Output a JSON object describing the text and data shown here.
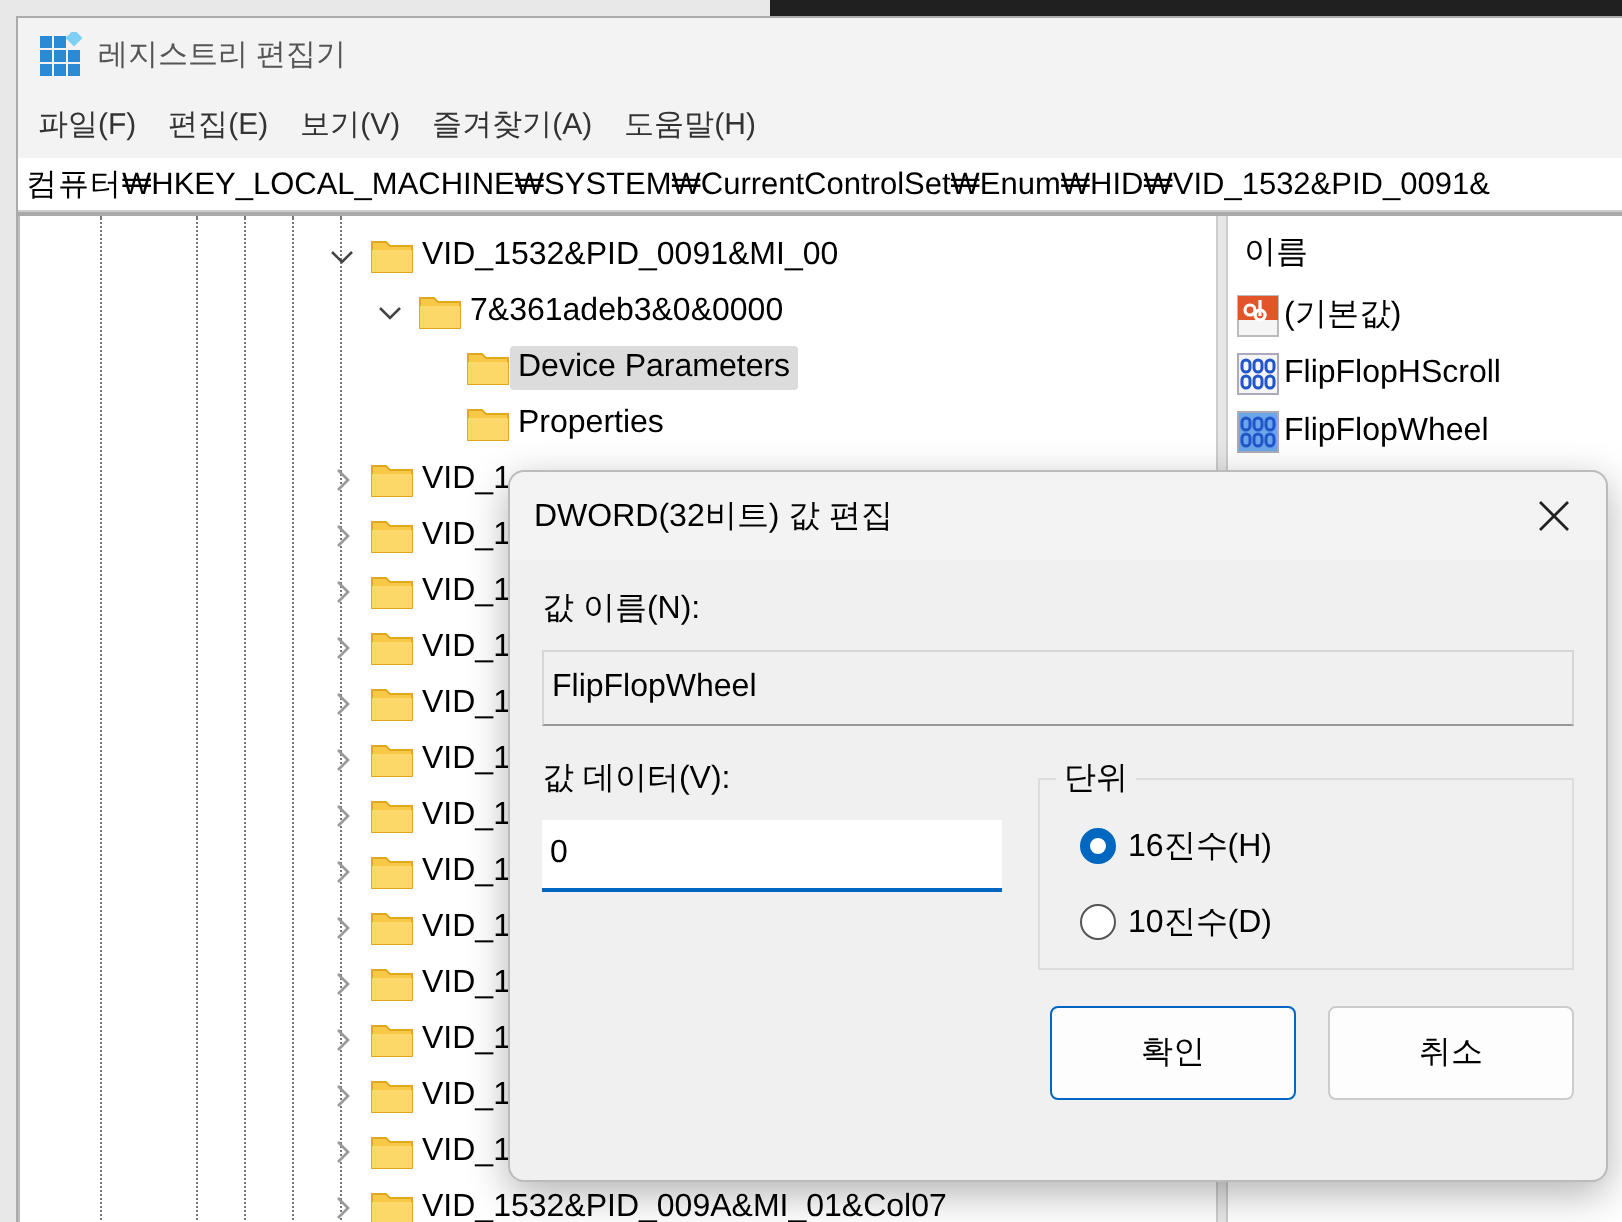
{
  "window": {
    "title": "레지스트리 편집기"
  },
  "menu": [
    "파일(F)",
    "편집(E)",
    "보기(V)",
    "즐겨찾기(A)",
    "도움말(H)"
  ],
  "address": "컴퓨터₩HKEY_LOCAL_MACHINE₩SYSTEM₩CurrentControlSet₩Enum₩HID₩VID_1532&PID_0091&",
  "tree": [
    {
      "label": "VID_1532&PID_0091&MI_00",
      "expanded": true,
      "selected": false,
      "children": [
        {
          "label": "7&361adeb3&0&0000",
          "expanded": true,
          "selected": false,
          "children": [
            {
              "label": "Device Parameters",
              "selected": true
            },
            {
              "label": "Properties",
              "selected": false
            }
          ]
        }
      ]
    },
    {
      "label": "VID_1",
      "expanded": false,
      "selected": false
    },
    {
      "label": "VID_1",
      "expanded": false,
      "selected": false
    },
    {
      "label": "VID_1",
      "expanded": false,
      "selected": false
    },
    {
      "label": "VID_1",
      "expanded": false,
      "selected": false
    },
    {
      "label": "VID_1",
      "expanded": false,
      "selected": false
    },
    {
      "label": "VID_1",
      "expanded": false,
      "selected": false
    },
    {
      "label": "VID_1",
      "expanded": false,
      "selected": false
    },
    {
      "label": "VID_1",
      "expanded": false,
      "selected": false
    },
    {
      "label": "VID_1",
      "expanded": false,
      "selected": false
    },
    {
      "label": "VID_1",
      "expanded": false,
      "selected": false
    },
    {
      "label": "VID_1",
      "expanded": false,
      "selected": false
    },
    {
      "label": "VID_1",
      "expanded": false,
      "selected": false
    },
    {
      "label": "VID_1",
      "expanded": false,
      "selected": false
    },
    {
      "label": "VID_1532&PID_009A&MI_01&Col07",
      "expanded": false,
      "selected": false
    }
  ],
  "values": {
    "column": "이름",
    "items": [
      {
        "name": "(기본값)",
        "kind": "string",
        "selected": false
      },
      {
        "name": "FlipFlopHScroll",
        "kind": "binary",
        "selected": false
      },
      {
        "name": "FlipFlopWheel",
        "kind": "binary",
        "selected": true
      }
    ]
  },
  "dialog": {
    "title": "DWORD(32비트) 값 편집",
    "name_label": "값 이름(N):",
    "name_value": "FlipFlopWheel",
    "data_label": "값 데이터(V):",
    "data_value": "0",
    "base_label": "단위",
    "bases": [
      {
        "label": "16진수(H)",
        "selected": true
      },
      {
        "label": "10진수(D)",
        "selected": false
      }
    ],
    "buttons": [
      {
        "label": "확인",
        "kind": "primary"
      },
      {
        "label": "취소",
        "kind": "secondary"
      }
    ]
  }
}
